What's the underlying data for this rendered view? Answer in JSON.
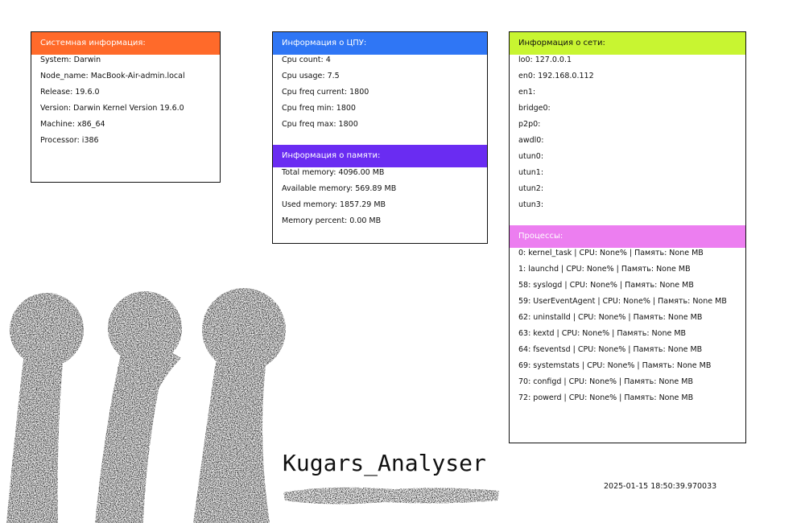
{
  "colors": {
    "system_header": "#ff6a2a",
    "cpu_header": "#2f76f5",
    "memory_header": "#6a2cf2",
    "network_header": "#c8f531",
    "processes_header": "#ec7ef0",
    "ink": "#111111"
  },
  "system": {
    "title": "Системная информация:",
    "rows": [
      "System: Darwin",
      "Node_name: MacBook-Air-admin.local",
      "Release: 19.6.0",
      "Version: Darwin Kernel Version 19.6.0",
      "Machine: x86_64",
      "Processor: i386"
    ]
  },
  "cpu": {
    "title": "Информация о ЦПУ:",
    "rows": [
      "Cpu count: 4",
      "Cpu usage: 7.5",
      "Cpu freq current: 1800",
      "Cpu freq min: 1800",
      "Cpu freq max: 1800"
    ]
  },
  "memory": {
    "title": "Информация о памяти:",
    "rows": [
      "Total memory: 4096.00 MB",
      "Available memory: 569.89 MB",
      "Used memory: 1857.29 MB",
      "Memory percent: 0.00 MB"
    ]
  },
  "network": {
    "title": "Информация о сети:",
    "rows": [
      "lo0: 127.0.0.1",
      "en0: 192.168.0.112",
      "en1:",
      "bridge0:",
      "p2p0:",
      "awdl0:",
      "utun0:",
      "utun1:",
      "utun2:",
      "utun3:"
    ]
  },
  "processes": {
    "title": "Процессы:",
    "rows": [
      "0: kernel_task | CPU: None% | Память: None MB",
      "1: launchd | CPU: None% | Память: None MB",
      "58: syslogd | CPU: None% | Память: None MB",
      "59: UserEventAgent | CPU: None% | Память: None MB",
      "62: uninstalld | CPU: None% | Память: None MB",
      "63: kextd | CPU: None% | Память: None MB",
      "64: fseventsd | CPU: None% | Память: None MB",
      "69: systemstats | CPU: None% | Память: None MB",
      "70: configd | CPU: None% | Память: None MB",
      "72: powerd | CPU: None% | Память: None MB"
    ]
  },
  "brand": "Kugars_Analyser",
  "timestamp": "2025-01-15 18:50:39.970033"
}
